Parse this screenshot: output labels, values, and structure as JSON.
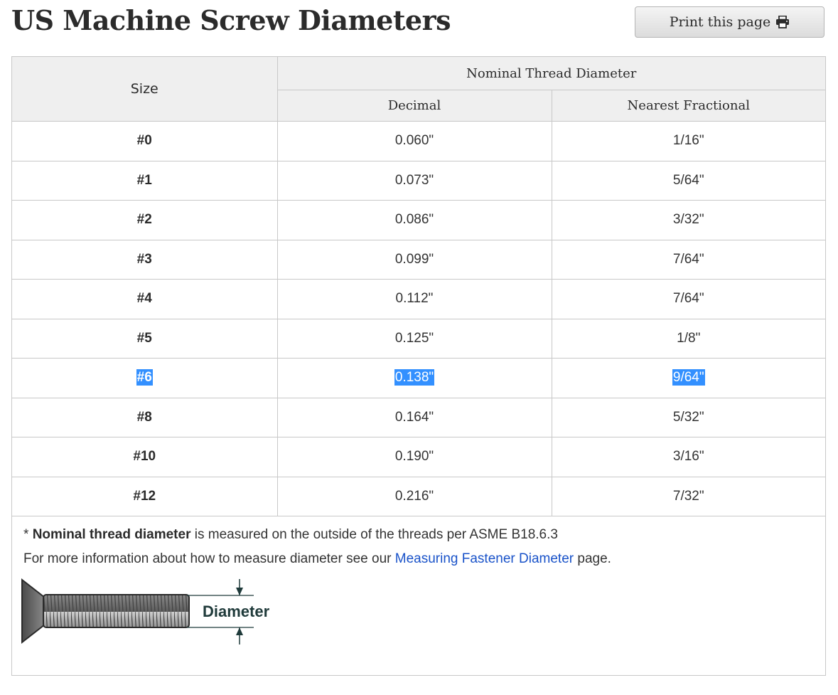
{
  "page": {
    "title": "US Machine Screw Diameters",
    "print_label": "Print this page",
    "print_icon": "printer-icon"
  },
  "table": {
    "header_size": "Size",
    "header_group": "Nominal Thread Diameter",
    "header_decimal": "Decimal",
    "header_fractional": "Nearest Fractional",
    "rows": [
      {
        "size": "#0",
        "decimal": "0.060\"",
        "fraction": "1/16\""
      },
      {
        "size": "#1",
        "decimal": "0.073\"",
        "fraction": "5/64\""
      },
      {
        "size": "#2",
        "decimal": "0.086\"",
        "fraction": "3/32\""
      },
      {
        "size": "#3",
        "decimal": "0.099\"",
        "fraction": "7/64\""
      },
      {
        "size": "#4",
        "decimal": "0.112\"",
        "fraction": "7/64\""
      },
      {
        "size": "#5",
        "decimal": "0.125\"",
        "fraction": "1/8\""
      },
      {
        "size": "#6",
        "decimal": "0.138\"",
        "fraction": "9/64\""
      },
      {
        "size": "#8",
        "decimal": "0.164\"",
        "fraction": "5/32\""
      },
      {
        "size": "#10",
        "decimal": "0.190\"",
        "fraction": "3/16\""
      },
      {
        "size": "#12",
        "decimal": "0.216\"",
        "fraction": "7/32\""
      }
    ],
    "selected_row": 6,
    "selection_color": "#3390ff"
  },
  "notes": {
    "asterisk": "* ",
    "term": "Nominal thread diameter",
    "line1_rest": " is measured on the outside of the threads per ASME B18.6.3",
    "line2_start": "For more information about how to measure diameter see our ",
    "link_text": "Measuring Fastener Diameter",
    "line2_end": " page.",
    "link_color": "#1a53c9"
  },
  "diagram": {
    "label": "Diameter",
    "label_color": "#1f3a3a"
  }
}
